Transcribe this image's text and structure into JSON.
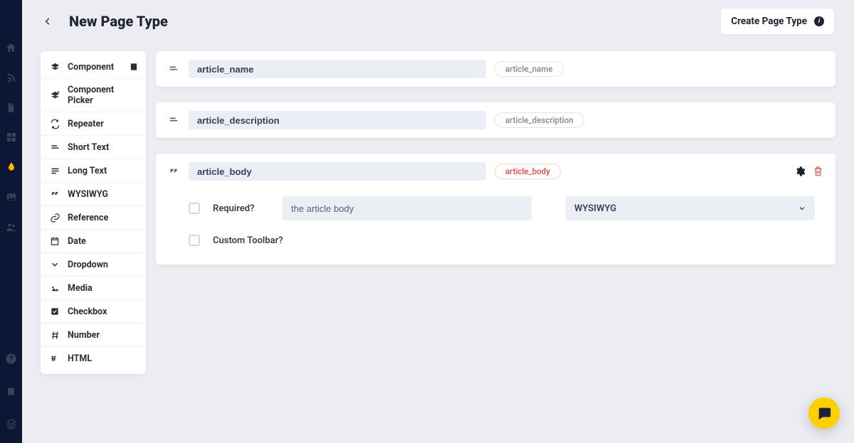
{
  "header": {
    "title": "New Page Type",
    "create_label": "Create Page Type"
  },
  "rail_icons": [
    "home-icon",
    "rss-icon",
    "document-icon",
    "grid-icon",
    "tint-icon",
    "image-icon",
    "users-icon"
  ],
  "field_types": [
    {
      "icon": "layers-icon",
      "label": "Component",
      "extra_icon": "book-icon"
    },
    {
      "icon": "layers-plus-icon",
      "label": "Component Picker"
    },
    {
      "icon": "repeat-icon",
      "label": "Repeater"
    },
    {
      "icon": "short-text-icon",
      "label": "Short Text"
    },
    {
      "icon": "long-text-icon",
      "label": "Long Text"
    },
    {
      "icon": "quote-icon",
      "label": "WYSIWYG"
    },
    {
      "icon": "link-icon",
      "label": "Reference"
    },
    {
      "icon": "calendar-icon",
      "label": "Date"
    },
    {
      "icon": "chevron-down-icon",
      "label": "Dropdown"
    },
    {
      "icon": "media-icon",
      "label": "Media"
    },
    {
      "icon": "checkbox-icon",
      "label": "Checkbox"
    },
    {
      "icon": "hash-icon",
      "label": "Number"
    },
    {
      "icon": "html-icon",
      "label": "HTML"
    }
  ],
  "fields": [
    {
      "icon": "short-text-icon",
      "name": "article_name",
      "slug": "article_name",
      "expanded": false,
      "slug_red": false
    },
    {
      "icon": "short-text-icon",
      "name": "article_description",
      "slug": "article_description",
      "expanded": false,
      "slug_red": false
    },
    {
      "icon": "quote-icon",
      "name": "article_body",
      "slug": "article_body",
      "expanded": true,
      "slug_red": true,
      "required_label": "Required?",
      "description": "the article body",
      "type_selected": "WYSIWYG",
      "custom_toolbar_label": "Custom Toolbar?"
    }
  ]
}
